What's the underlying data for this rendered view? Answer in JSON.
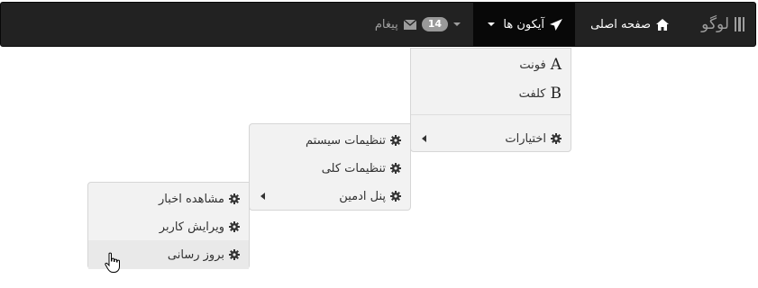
{
  "navbar": {
    "brand": "لوگو",
    "items": [
      {
        "label": "صفحه اصلی",
        "icon": "home-icon"
      },
      {
        "label": "آیکون ها",
        "icon": "send-icon"
      },
      {
        "label": "پیغام",
        "icon": "envelope-icon",
        "badge": "14"
      }
    ]
  },
  "menu1": {
    "items": [
      {
        "letter": "A",
        "label": "فونت"
      },
      {
        "letter": "B",
        "label": "کلفت"
      },
      {
        "label": "اختیارات",
        "icon": "gear-icon",
        "has_submenu": true
      }
    ]
  },
  "menu2": {
    "items": [
      {
        "label": "تنظیمات سیستم",
        "icon": "gear-icon"
      },
      {
        "label": "تنظیمات کلی",
        "icon": "gear-icon"
      },
      {
        "label": "پنل ادمین",
        "icon": "gear-icon",
        "has_submenu": true
      }
    ]
  },
  "menu3": {
    "items": [
      {
        "label": "مشاهده اخبار",
        "icon": "gear-icon"
      },
      {
        "label": "ویرایش کاربر",
        "icon": "gear-icon"
      },
      {
        "label": "بروز رسانی",
        "icon": "gear-icon",
        "hovered": true
      }
    ]
  },
  "colors": {
    "navbar_bg": "#222222",
    "active_bg": "#080808",
    "menu_bg": "#f2f2f2",
    "badge_bg": "#999999"
  }
}
